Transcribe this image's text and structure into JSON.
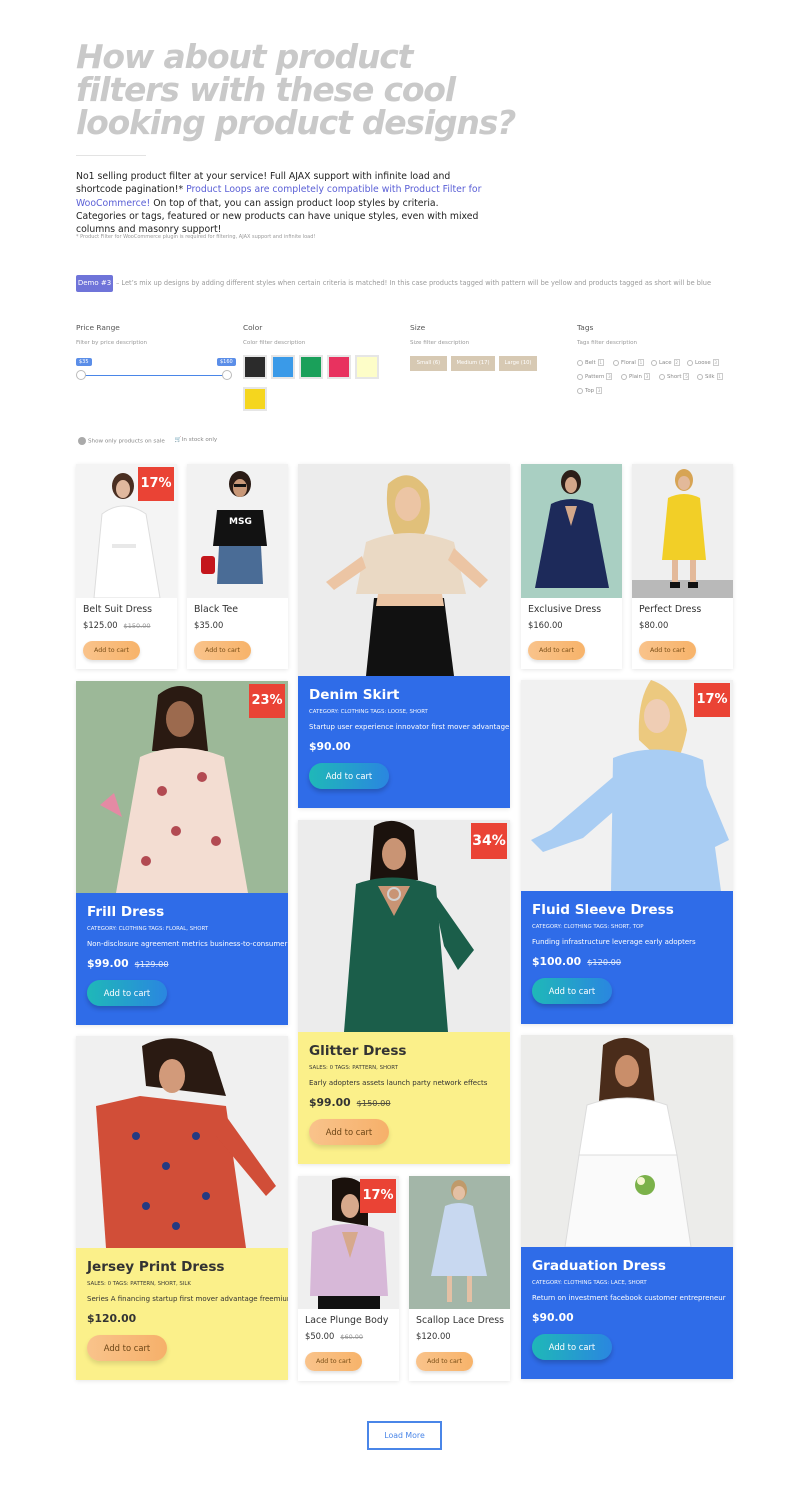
{
  "colors": {
    "accent": "#4a86e8",
    "sale_badge": "#ea4335",
    "blue_panel": "#2f6ce8",
    "yellow_panel": "#fbf08a",
    "demo_badge": "#6f74d9"
  },
  "hero": {
    "title": "How about product filters with these cool looking product designs?",
    "intro_1": "No1 selling product filter at your service! Full AJAX support with infinite load and shortcode pagination!*",
    "intro_link": "Product Loops are completely compatible with Product Filter for WooCommerce!",
    "intro_2": "On top of that, you can assign product loop styles by criteria. Categories or tags, featured or new products can have unique styles, even with mixed columns and masonry support!",
    "note": "* Product Filter for WooCommerce plugin is required for filtering, AJAX support and infinite load!"
  },
  "demo": {
    "badge": "Demo #3",
    "text": "– Let’s mix up designs by adding different styles when certain criteria is matched! In this case products tagged with pattern will be yellow and products tagged as short will be blue"
  },
  "filters": {
    "price": {
      "title": "Price Range",
      "desc": "Filter by price description",
      "min_label": "$35",
      "max_label": "$160"
    },
    "color": {
      "title": "Color",
      "desc": "Color filter description",
      "swatches": [
        "#2b2b2b",
        "#3a9ae8",
        "#1aa05a",
        "#e8325f",
        "#fdfdc8",
        "#f5d61e"
      ]
    },
    "size": {
      "title": "Size",
      "desc": "Size filter description",
      "options": [
        "Small (6)",
        "Medium (17)",
        "Large (10)"
      ]
    },
    "tags": {
      "title": "Tags",
      "desc": "Tags filter description",
      "items": [
        {
          "label": "Belt",
          "count": "1"
        },
        {
          "label": "Floral",
          "count": "1"
        },
        {
          "label": "Lace",
          "count": "2"
        },
        {
          "label": "Loose",
          "count": "3"
        },
        {
          "label": "Pattern",
          "count": "3"
        },
        {
          "label": "Plain",
          "count": "3"
        },
        {
          "label": "Short",
          "count": "5"
        },
        {
          "label": "Silk",
          "count": "1"
        },
        {
          "label": "Top",
          "count": "3"
        }
      ]
    },
    "toggles": {
      "on_sale": "Show only products on sale",
      "in_stock": "In stock only"
    }
  },
  "products": {
    "belt_suit": {
      "name": "Belt Suit Dress",
      "price": "$125.00",
      "old": "$150.00",
      "sale": "17%",
      "btn": "Add to cart"
    },
    "black_tee": {
      "name": "Black Tee",
      "price": "$35.00",
      "btn": "Add to cart"
    },
    "denim_skirt": {
      "name": "Denim Skirt",
      "meta": "CATEGORY: CLOTHING TAGS: LOOSE, SHORT",
      "desc": "Startup user experience innovator first mover advantage",
      "price": "$90.00",
      "btn": "Add to cart"
    },
    "exclusive": {
      "name": "Exclusive Dress",
      "price": "$160.00",
      "btn": "Add to cart"
    },
    "perfect": {
      "name": "Perfect Dress",
      "price": "$80.00",
      "btn": "Add to cart"
    },
    "frill": {
      "name": "Frill Dress",
      "meta": "CATEGORY: CLOTHING TAGS: FLORAL, SHORT",
      "desc": "Non-disclosure agreement metrics business-to-consumer",
      "price": "$99.00",
      "old": "$129.00",
      "sale": "23%",
      "btn": "Add to cart"
    },
    "glitter": {
      "name": "Glitter Dress",
      "meta": "SALES: 0 TAGS: PATTERN, SHORT",
      "desc": "Early adopters assets launch party network effects",
      "price": "$99.00",
      "old": "$150.00",
      "sale": "34%",
      "btn": "Add to cart"
    },
    "fluid": {
      "name": "Fluid Sleeve Dress",
      "meta": "CATEGORY: CLOTHING TAGS: SHORT, TOP",
      "desc": "Funding infrastructure leverage early adopters",
      "price": "$100.00",
      "old": "$120.00",
      "sale": "17%",
      "btn": "Add to cart"
    },
    "jersey": {
      "name": "Jersey Print Dress",
      "meta": "SALES: 0 TAGS: PATTERN, SHORT, SILK",
      "desc": "Series A financing startup first mover advantage freemium",
      "price": "$120.00",
      "btn": "Add to cart"
    },
    "lace_plunge": {
      "name": "Lace Plunge Body",
      "price": "$50.00",
      "old": "$60.00",
      "sale": "17%",
      "btn": "Add to cart"
    },
    "scallop": {
      "name": "Scallop Lace Dress",
      "price": "$120.00",
      "btn": "Add to cart"
    },
    "graduation": {
      "name": "Graduation Dress",
      "meta": "CATEGORY: CLOTHING TAGS: LACE, SHORT",
      "desc": "Return on investment facebook customer entrepreneur",
      "price": "$90.00",
      "btn": "Add to cart"
    }
  },
  "load_more": "Load More"
}
